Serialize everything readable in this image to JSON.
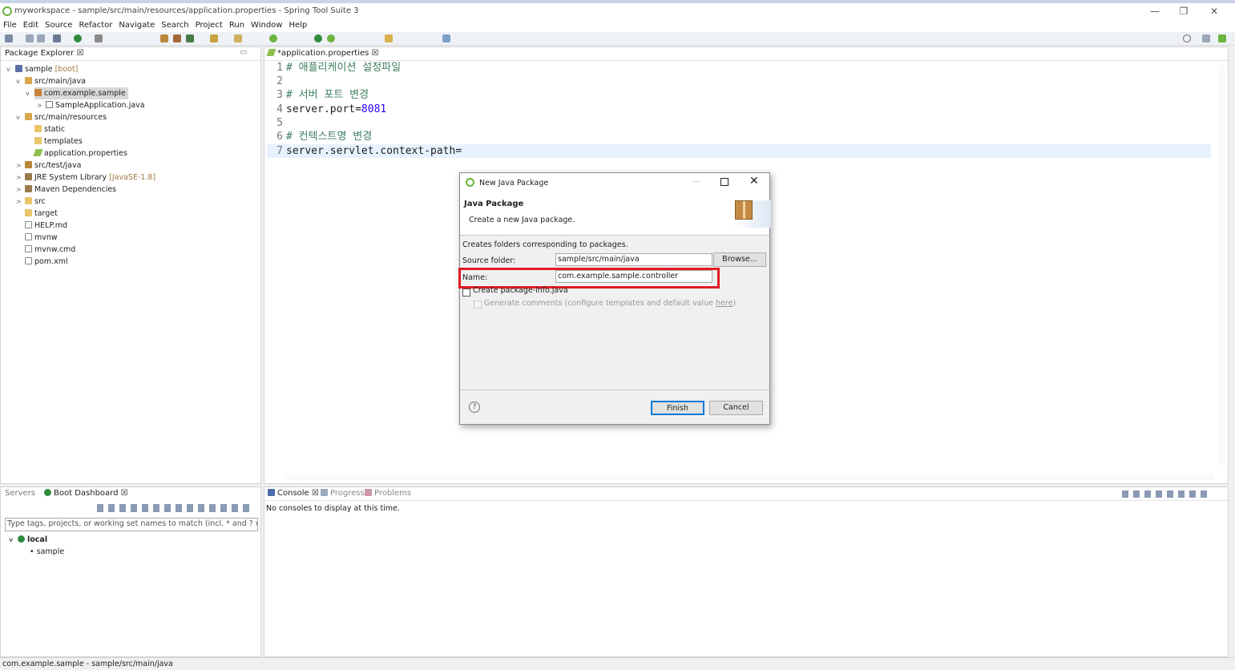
{
  "window": {
    "title": "myworkspace - sample/src/main/resources/application.properties - Spring Tool Suite 3",
    "minimize": "—",
    "maximize": "❐",
    "close": "✕"
  },
  "menu": [
    "File",
    "Edit",
    "Source",
    "Refactor",
    "Navigate",
    "Search",
    "Project",
    "Run",
    "Window",
    "Help"
  ],
  "package_explorer": {
    "tab": "Package Explorer ☒",
    "tree": [
      {
        "label": "sample",
        "decoration": "[boot]",
        "twisty": "v",
        "icon": "project-icon"
      },
      {
        "label": "src/main/java",
        "twisty": "v",
        "icon": "source-folder-icon"
      },
      {
        "label": "com.example.sample",
        "twisty": "v",
        "icon": "package-icon",
        "selected": true
      },
      {
        "label": "SampleApplication.java",
        "twisty": ">",
        "icon": "java-file-icon"
      },
      {
        "label": "src/main/resources",
        "twisty": "v",
        "icon": "source-folder-icon"
      },
      {
        "label": "static",
        "twisty": "",
        "icon": "folder-icon"
      },
      {
        "label": "templates",
        "twisty": "",
        "icon": "folder-icon"
      },
      {
        "label": "application.properties",
        "twisty": "",
        "icon": "properties-file-icon"
      },
      {
        "label": "src/test/java",
        "twisty": ">",
        "icon": "source-folder-icon"
      },
      {
        "label": "JRE System Library",
        "decoration": "[JavaSE-1.8]",
        "twisty": ">",
        "icon": "library-icon"
      },
      {
        "label": "Maven Dependencies",
        "twisty": ">",
        "icon": "library-icon"
      },
      {
        "label": "src",
        "twisty": ">",
        "icon": "folder-icon"
      },
      {
        "label": "target",
        "twisty": "",
        "icon": "folder-icon"
      },
      {
        "label": "HELP.md",
        "twisty": "",
        "icon": "file-icon"
      },
      {
        "label": "mvnw",
        "twisty": "",
        "icon": "file-icon"
      },
      {
        "label": "mvnw.cmd",
        "twisty": "",
        "icon": "file-icon"
      },
      {
        "label": "pom.xml",
        "twisty": "",
        "icon": "xml-file-icon"
      }
    ]
  },
  "editor": {
    "tab": "*application.properties ☒",
    "lines": [
      {
        "n": "1",
        "comment": "# 애플리케이션 설정파일"
      },
      {
        "n": "2"
      },
      {
        "n": "3",
        "comment": "# 서버 포트 변경"
      },
      {
        "n": "4",
        "key": "server.port=",
        "value": "8081"
      },
      {
        "n": "5"
      },
      {
        "n": "6",
        "comment": "# 컨텍스트명 변경"
      },
      {
        "n": "7",
        "key": "server.servlet.context-path=",
        "current": true
      }
    ]
  },
  "dialog": {
    "title": "New Java Package",
    "heading": "Java Package",
    "subheading": "Create a new Java package.",
    "description": "Creates folders corresponding to packages.",
    "source_folder_label": "Source folder:",
    "source_folder_value": "sample/src/main/java",
    "browse_label": "Browse...",
    "name_label": "Name:",
    "name_value": "com.example.sample.controller",
    "create_package_info_label": "Create package-info.java",
    "generate_comments_label": "Generate comments (configure templates and default value ",
    "here_link": "here",
    "generate_comments_suffix": ")",
    "help_symbol": "?",
    "finish_label": "Finish",
    "cancel_label": "Cancel",
    "highlight_color": "#e01b24"
  },
  "servers_pane": {
    "tabs": [
      "Servers",
      "Boot Dashboard ☒"
    ],
    "filter_placeholder": "Type tags, projects, or working set names to match (incl. * and ? wildca",
    "tree": [
      {
        "label": "local",
        "level": 0
      },
      {
        "label": "sample",
        "level": 1
      }
    ]
  },
  "console_pane": {
    "tabs": [
      "Console ☒",
      "Progress",
      "Problems"
    ],
    "message": "No consoles to display at this time."
  },
  "status_bar": "com.example.sample - sample/src/main/java",
  "colors": {
    "accent": "#6db33f",
    "selection": "#d9d9d9",
    "current_line": "#e8f2fe"
  }
}
